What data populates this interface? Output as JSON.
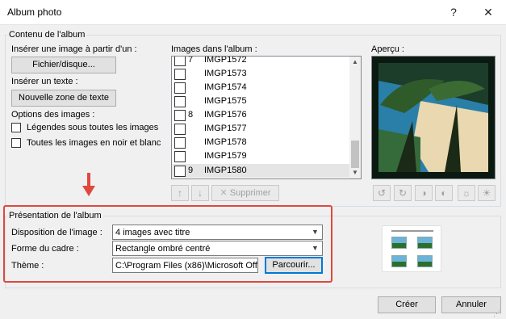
{
  "window": {
    "title": "Album photo",
    "help": "?",
    "close": "✕"
  },
  "contents_group": {
    "legend": "Contenu de l'album",
    "insert_image_label": "Insérer une image à partir d'un :",
    "file_disk_button": "Fichier/disque...",
    "insert_text_label": "Insérer un texte :",
    "new_textbox_button": "Nouvelle zone de texte",
    "image_options_label": "Options des images :",
    "captions_checkbox": {
      "label": "Légendes sous toutes les images",
      "checked": false
    },
    "bw_checkbox": {
      "label": "Toutes les images en noir et blanc",
      "checked": false
    }
  },
  "album_list": {
    "label": "Images dans l'album :",
    "items": [
      {
        "num": "7",
        "name": "IMGP1572"
      },
      {
        "num": "",
        "name": "IMGP1573"
      },
      {
        "num": "",
        "name": "IMGP1574"
      },
      {
        "num": "",
        "name": "IMGP1575"
      },
      {
        "num": "8",
        "name": "IMGP1576"
      },
      {
        "num": "",
        "name": "IMGP1577"
      },
      {
        "num": "",
        "name": "IMGP1578"
      },
      {
        "num": "",
        "name": "IMGP1579"
      },
      {
        "num": "9",
        "name": "IMGP1580"
      }
    ],
    "selected_index": 8,
    "move_up_icon": "arrow-up-icon",
    "move_down_icon": "arrow-down-icon",
    "delete_button": "Supprimer"
  },
  "preview": {
    "label": "Aperçu :"
  },
  "layout_group": {
    "legend": "Présentation de l'album",
    "layout_label": "Disposition de l'image :",
    "layout_value": "4 images avec titre",
    "frame_label": "Forme du cadre :",
    "frame_value": "Rectangle ombré centré",
    "theme_label": "Thème :",
    "theme_value": "C:\\Program Files (x86)\\Microsoft Off",
    "browse_button": "Parcourir..."
  },
  "footer": {
    "create_button": "Créer",
    "cancel_button": "Annuler"
  },
  "colors": {
    "annotation_red": "#e0483e",
    "focus_blue": "#0078d7"
  }
}
